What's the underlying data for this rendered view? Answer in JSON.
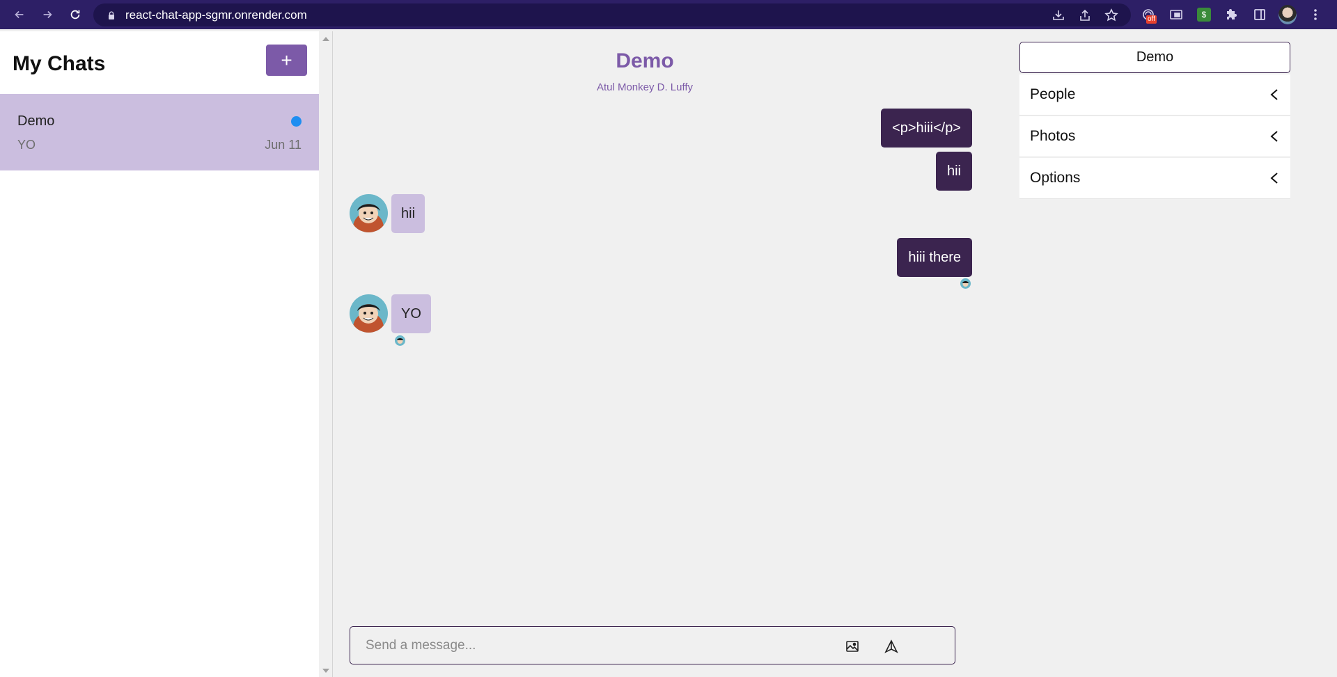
{
  "browser": {
    "url": "react-chat-app-sgmr.onrender.com",
    "extension_badge": "off",
    "extension_green_label": "$"
  },
  "sidebar": {
    "title": "My Chats",
    "new_chat_label": "+",
    "chats": [
      {
        "title": "Demo",
        "preview": "YO",
        "date": "Jun 11",
        "unread": true
      }
    ]
  },
  "chat": {
    "title": "Demo",
    "subtitle": "Atul Monkey D. Luffy",
    "messages": [
      {
        "direction": "out",
        "text": "<p>hiii</p>"
      },
      {
        "direction": "out",
        "text": "hii"
      },
      {
        "direction": "in",
        "text": "hii"
      },
      {
        "direction": "out",
        "text": "hiii there"
      },
      {
        "direction": "in",
        "text": "YO"
      }
    ],
    "composer": {
      "placeholder": "Send a message..."
    }
  },
  "settings": {
    "title": "Demo",
    "sections": [
      "People",
      "Photos",
      "Options"
    ]
  },
  "colors": {
    "accent": "#7c5aa8",
    "outgoing_bubble": "#3b244f",
    "incoming_bubble": "#cbbedf",
    "unread_dot": "#1f8ef1",
    "browser_chrome": "#2d1f66"
  }
}
